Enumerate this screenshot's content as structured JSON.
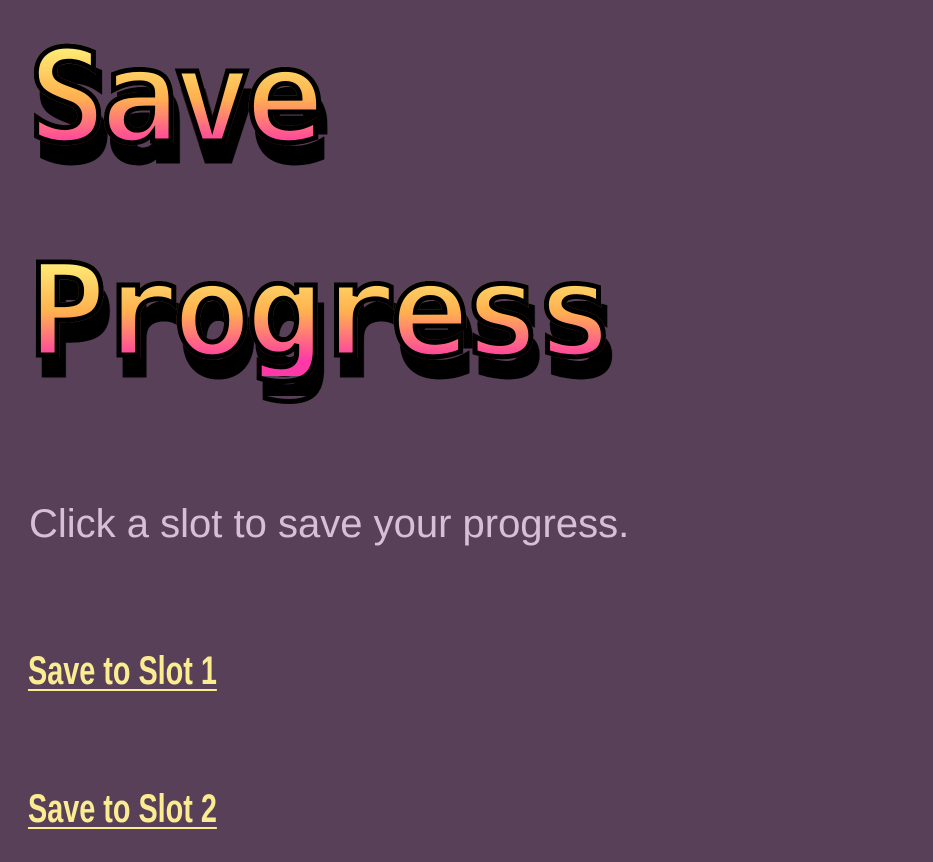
{
  "title": {
    "line1": "Save",
    "line2": "Progress"
  },
  "subtitle": "Click a slot to save your progress.",
  "slots": [
    {
      "label": "Save to Slot 1"
    },
    {
      "label": "Save to Slot 2"
    }
  ],
  "colors": {
    "background": "#574058",
    "title_gradient_top": "#fdf57b",
    "title_gradient_mid": "#ffb04f",
    "title_gradient_bottom": "#ff38a8",
    "title_outline": "#000000",
    "subtitle_text": "#d7bfd8",
    "link_text": "#fbeb91"
  }
}
